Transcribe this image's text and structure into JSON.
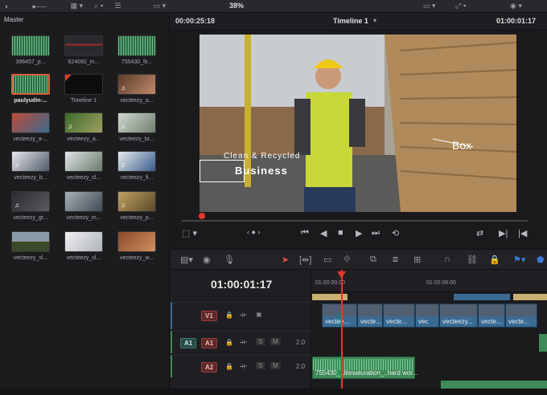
{
  "toolbar": {
    "zoom": "38%"
  },
  "media_pool": {
    "title": "Master",
    "clips": [
      {
        "label": "396457_p...",
        "selected": false
      },
      {
        "label": "624092_m...",
        "selected": false
      },
      {
        "label": "755430_lit...",
        "selected": false
      },
      {
        "label": "paulyudin-...",
        "selected": true
      },
      {
        "label": "Timeline 1",
        "selected": false
      },
      {
        "label": "vecteezy_a...",
        "selected": false
      },
      {
        "label": "vecteezy_a-...",
        "selected": false
      },
      {
        "label": "vecteezy_a...",
        "selected": false
      },
      {
        "label": "vecteezy_br...",
        "selected": false
      },
      {
        "label": "vecteezy_b...",
        "selected": false
      },
      {
        "label": "vecteezy_cl...",
        "selected": false
      },
      {
        "label": "vecteezy_fi...",
        "selected": false
      },
      {
        "label": "vecteezy_gr...",
        "selected": false
      },
      {
        "label": "vecteezy_m...",
        "selected": false
      },
      {
        "label": "vecteezy_p...",
        "selected": false
      },
      {
        "label": "vecteezy_sl...",
        "selected": false
      },
      {
        "label": "vecteezy_sl...",
        "selected": false
      },
      {
        "label": "vecteezy_w...",
        "selected": false
      }
    ]
  },
  "viewer": {
    "source_timecode": "00:00:25:18",
    "timeline_name": "Timeline 1",
    "record_timecode": "01:00:01:17",
    "overlay_line1": "Clean & Recycled",
    "overlay_line2": "Business",
    "overlay_box_label": "Box"
  },
  "timeline": {
    "timecode": "01:00:01:17",
    "ruler": [
      "01:00:00:00",
      "01:00:06:00"
    ],
    "tracks": {
      "v1": "V1",
      "a1_left": "A1",
      "a1": "A1",
      "a2": "A2",
      "a1_level": "2.0",
      "a2_level": "2.0",
      "solo": "S",
      "mute": "M"
    },
    "video_clips": [
      "vectee...",
      "vecte...",
      "vecte...",
      "vec",
      "vecteezy...",
      "vecte...",
      "vecte..."
    ],
    "audio_clip": "755430_..litesaturation_..hard wor..."
  }
}
